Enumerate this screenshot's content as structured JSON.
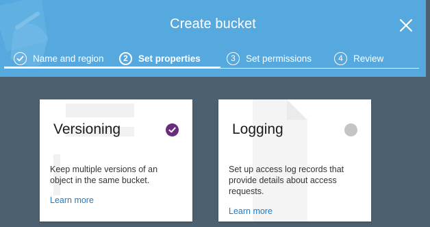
{
  "dialog": {
    "title": "Create bucket",
    "close_icon": "close-icon"
  },
  "steps": [
    {
      "marker": "check",
      "label": "Name and region",
      "state": "completed"
    },
    {
      "marker": "2",
      "label": "Set properties",
      "state": "active"
    },
    {
      "marker": "3",
      "label": "Set permissions",
      "state": "upcoming"
    },
    {
      "marker": "4",
      "label": "Review",
      "state": "upcoming"
    }
  ],
  "cards": [
    {
      "title": "Versioning",
      "description": "Keep multiple versions of an object in the same bucket.",
      "link": "Learn more",
      "enabled": true,
      "status_icon": "check-circle-icon"
    },
    {
      "title": "Logging",
      "description": "Set up access log records that provide details about access requests.",
      "link": "Learn more",
      "enabled": false,
      "status_icon": "disabled-circle-icon"
    }
  ],
  "colors": {
    "header": "#56a9de",
    "backdrop": "#4c6070",
    "enabled": "#6b2d7b",
    "disabled": "#c4c4c4",
    "link": "#1f7ac2"
  }
}
